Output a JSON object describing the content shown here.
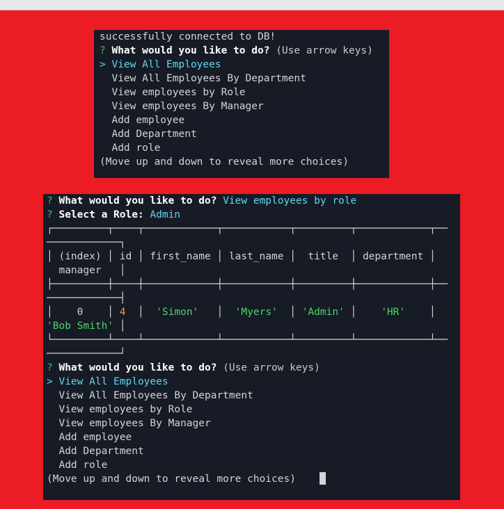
{
  "colors": {
    "page_background": "#ec1c24",
    "terminal_background": "#161b26",
    "prompt_mark": "#3fbf5f",
    "selected_choice": "#61d6f0",
    "table_number": "#e8a33c",
    "table_string": "#4fd46b"
  },
  "terminal1": {
    "connect_msg": "successfully connected to DB!",
    "prompt_mark": "?",
    "question": "What would you like to do?",
    "hint": "(Use arrow keys)",
    "pointer": ">",
    "selected": "View All Employees",
    "choices": [
      "View All Employees By Department",
      "View employees by Role",
      "View employees By Manager",
      "Add employee",
      "Add Department",
      "Add role"
    ],
    "more_hint": "(Move up and down to reveal more choices)"
  },
  "terminal2": {
    "prompt_mark": "?",
    "question1": "What would you like to do?",
    "answer1": "View employees by role",
    "question2": "Select a Role:",
    "answer2": "Admin",
    "table": {
      "border_top": "┌─────────┬────┬────────────┬───────────┬─────────┬────────────┬──",
      "border_top_wrap": "────────────┐",
      "header_line": "│ (index) │ id │ first_name │ last_name │  title  │ department │",
      "header_wrap": "  manager   │",
      "divider": "├─────────┼────┼────────────┼───────────┼─────────┼────────────┼──",
      "divider_wrap": "────────────┤",
      "headers": [
        "(index)",
        "id",
        "first_name",
        "last_name",
        "title",
        "department",
        "manager"
      ],
      "row": {
        "index": "0",
        "id": "4",
        "first_name": "'Simon'",
        "last_name": "'Myers'",
        "title": "'Admin'",
        "department": "'HR'",
        "manager": "'Bob Smith'"
      },
      "border_bottom": "└─────────┴────┴────────────┴───────────┴─────────┴────────────┴──",
      "border_bottom_wrap": "────────────┘"
    },
    "question3": "What would you like to do?",
    "hint": "(Use arrow keys)",
    "pointer": ">",
    "selected": "View All Employees",
    "choices": [
      "View All Employees By Department",
      "View employees by Role",
      "View employees By Manager",
      "Add employee",
      "Add Department",
      "Add role"
    ],
    "more_hint": "(Move up and down to reveal more choices)"
  }
}
